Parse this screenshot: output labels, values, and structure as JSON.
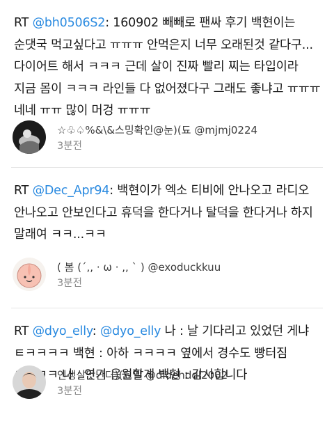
{
  "tweets": [
    {
      "rt": "RT",
      "mention": "@bh0506S2",
      "text": ": 160902 빼빼로 팬싸 후기 백현이는 순댓국 먹고싶다고 ㅠㅠㅠ 안먹은지 너무 오래된것 같다구... 다이어트 해서 ㅋㅋㅋ 근데 살이 진짜 빨리 찌는 타입이라 지금 몸이 ㅋㅋㅋ 라인들 다 없어졌다구 그래도 좋냐고 ㅠㅠㅠ 네네 ㅠㅠ 많이 머겅 ㅠㅠㅠ",
      "author": "☆♧♤%&\\&스밍확인@눈)(됴 @mjmj0224",
      "time": "3분전",
      "avatar_icon": "dark-figure-avatar"
    },
    {
      "rt": "RT",
      "mention": "@Dec_Apr94",
      "text": ": 백현이가 엑소 티비에 안나오고 라디오 안나오고 안보인다고 휴덕을 한다거나 탈덕을 한다거나 하지 말래여 ㅋㅋ...ㅋㅋ",
      "author": "( 봄 (´,, · ω · ,, ` ) @exoduckkuu",
      "time": "3분전",
      "avatar_icon": "peach-character-avatar"
    },
    {
      "rt": "RT",
      "mention": "@dyo_elly",
      "mention2": "@dyo_elly",
      "sep": ": ",
      "text": " 나 : 날 기다리고 있었던 게냐 ㅌㅋㅋㅋㅋ 백현 : 아하 ㅋㅋㅋㅋ 옆에서 경수도 빵터짐 ㅋㅋㅋㅋ 나 : 연기 응원할게 백현 : 감사합니다",
      "author": "인생살맛난다)(됴엘 @didehddl2002",
      "time": "3분전",
      "avatar_icon": "person-photo-avatar"
    }
  ],
  "colors": {
    "mention": "#2a8ae0",
    "time": "#8a8a8a",
    "divider": "#e4e4e4"
  }
}
